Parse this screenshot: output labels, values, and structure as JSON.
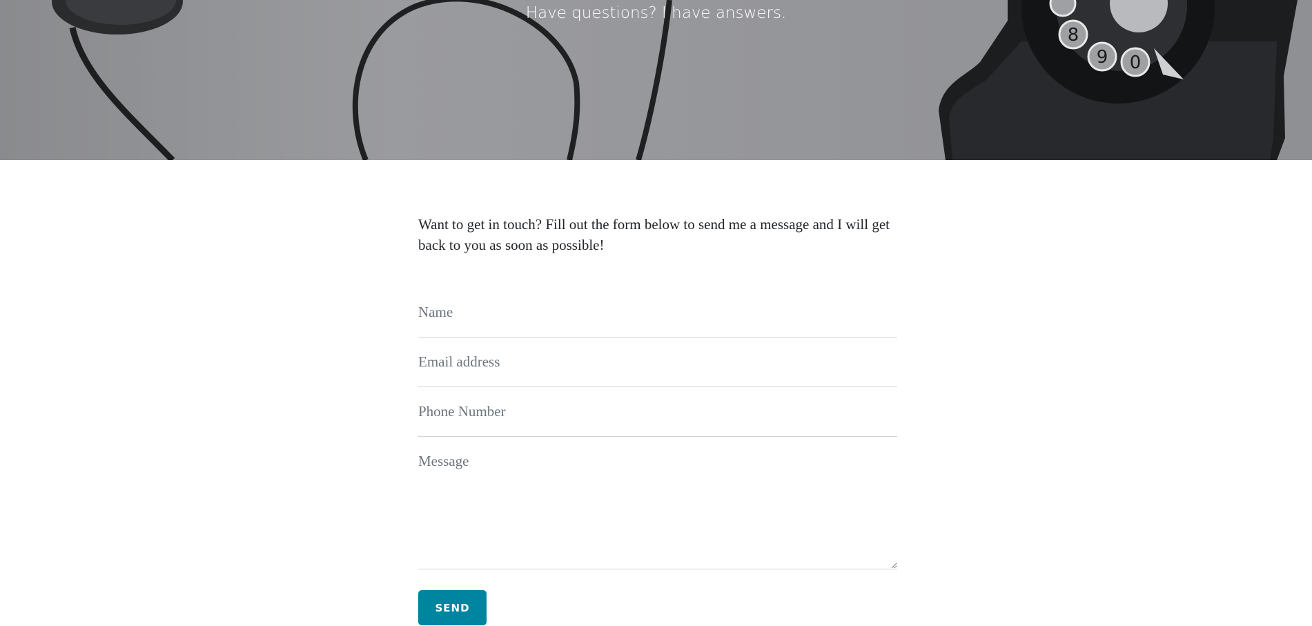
{
  "hero": {
    "subtitle": "Have questions? I have answers.",
    "background_image": "rotary-telephone-photo"
  },
  "contact": {
    "intro": "Want to get in touch? Fill out the form below to send me a message and I will get back to you as soon as possible!",
    "name_placeholder": "Name",
    "email_placeholder": "Email address",
    "phone_placeholder": "Phone Number",
    "message_placeholder": "Message",
    "send_label": "SEND"
  },
  "colors": {
    "accent": "#0085a1",
    "text": "#212529",
    "placeholder": "#6c757d",
    "border": "#ced4da"
  }
}
